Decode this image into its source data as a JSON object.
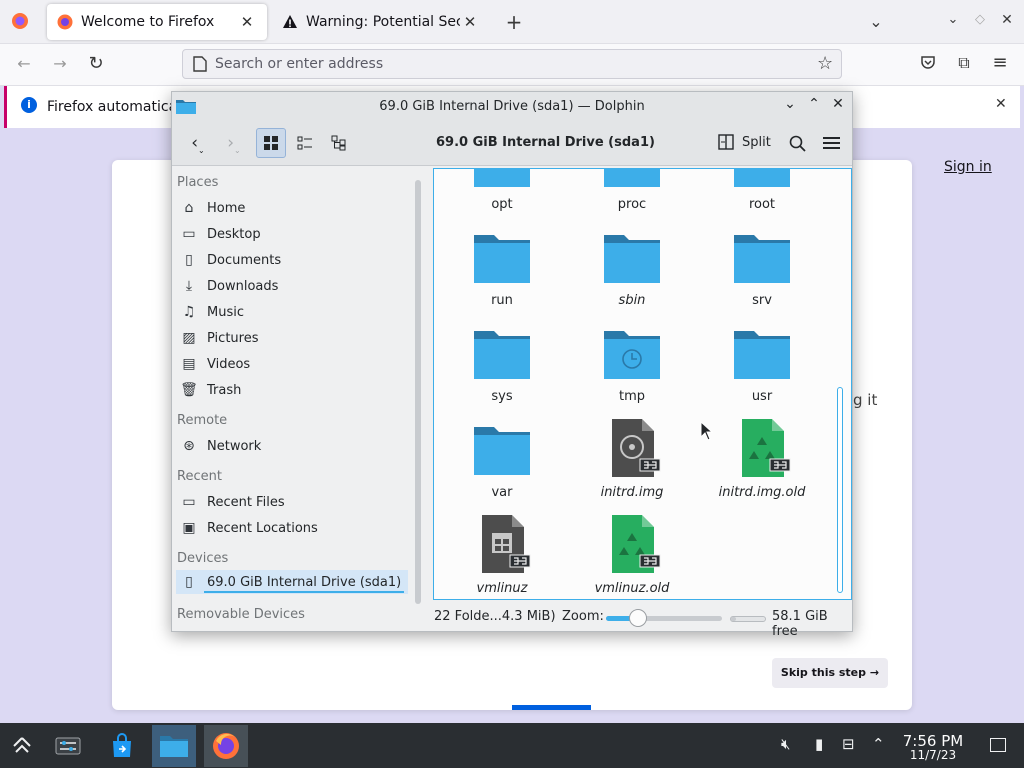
{
  "firefox": {
    "tabs": [
      {
        "label": "Welcome to Firefox"
      },
      {
        "label": "Warning: Potential Security Risk Ahead"
      }
    ],
    "url_placeholder": "Search or enter address",
    "notice": "Firefox automatically sends some data to Mozilla so that we can improve your experience.",
    "sign_in": "Sign in",
    "partial_text": "g it",
    "skip_label": "Skip this step →"
  },
  "dolphin": {
    "window_title": "69.0 GiB Internal Drive (sda1) — Dolphin",
    "breadcrumb": "69.0 GiB Internal Drive (sda1)",
    "split_label": "Split",
    "places": {
      "section_places": "Places",
      "home": "Home",
      "desktop": "Desktop",
      "documents": "Documents",
      "downloads": "Downloads",
      "music": "Music",
      "pictures": "Pictures",
      "videos": "Videos",
      "trash": "Trash",
      "section_remote": "Remote",
      "network": "Network",
      "section_recent": "Recent",
      "recent_files": "Recent Files",
      "recent_locations": "Recent Locations",
      "section_devices": "Devices",
      "internal_drive": "69.0 GiB Internal Drive (sda1)",
      "section_removable": "Removable Devices"
    },
    "files": [
      {
        "name": "opt",
        "kind": "folder",
        "italic": false
      },
      {
        "name": "proc",
        "kind": "folder",
        "italic": false
      },
      {
        "name": "root",
        "kind": "folder",
        "italic": false
      },
      {
        "name": "run",
        "kind": "folder",
        "italic": false
      },
      {
        "name": "sbin",
        "kind": "folder",
        "italic": true
      },
      {
        "name": "srv",
        "kind": "folder",
        "italic": false
      },
      {
        "name": "sys",
        "kind": "folder",
        "italic": false
      },
      {
        "name": "tmp",
        "kind": "folder-clock",
        "italic": false
      },
      {
        "name": "usr",
        "kind": "folder",
        "italic": false
      },
      {
        "name": "var",
        "kind": "folder",
        "italic": false
      },
      {
        "name": "initrd.img",
        "kind": "disk-image-link",
        "italic": true
      },
      {
        "name": "initrd.img.old",
        "kind": "recycle-link",
        "italic": true
      },
      {
        "name": "vmlinuz",
        "kind": "binary-link",
        "italic": true
      },
      {
        "name": "vmlinuz.old",
        "kind": "recycle-link",
        "italic": true
      }
    ],
    "status": {
      "count": "22 Folde...4.3 MiB)",
      "zoom_label": "Zoom:",
      "zoom_level": 0.28,
      "disk_used_fraction": 0.16,
      "free": "58.1 GiB free"
    }
  },
  "taskbar": {
    "time": "7:56 PM",
    "date": "11/7/23"
  },
  "colors": {
    "accent": "#3daee9",
    "folder": "#3daee9",
    "folder_tab": "#2a79a9",
    "recycle": "#27ae60",
    "firefox_blue": "#0060df"
  }
}
